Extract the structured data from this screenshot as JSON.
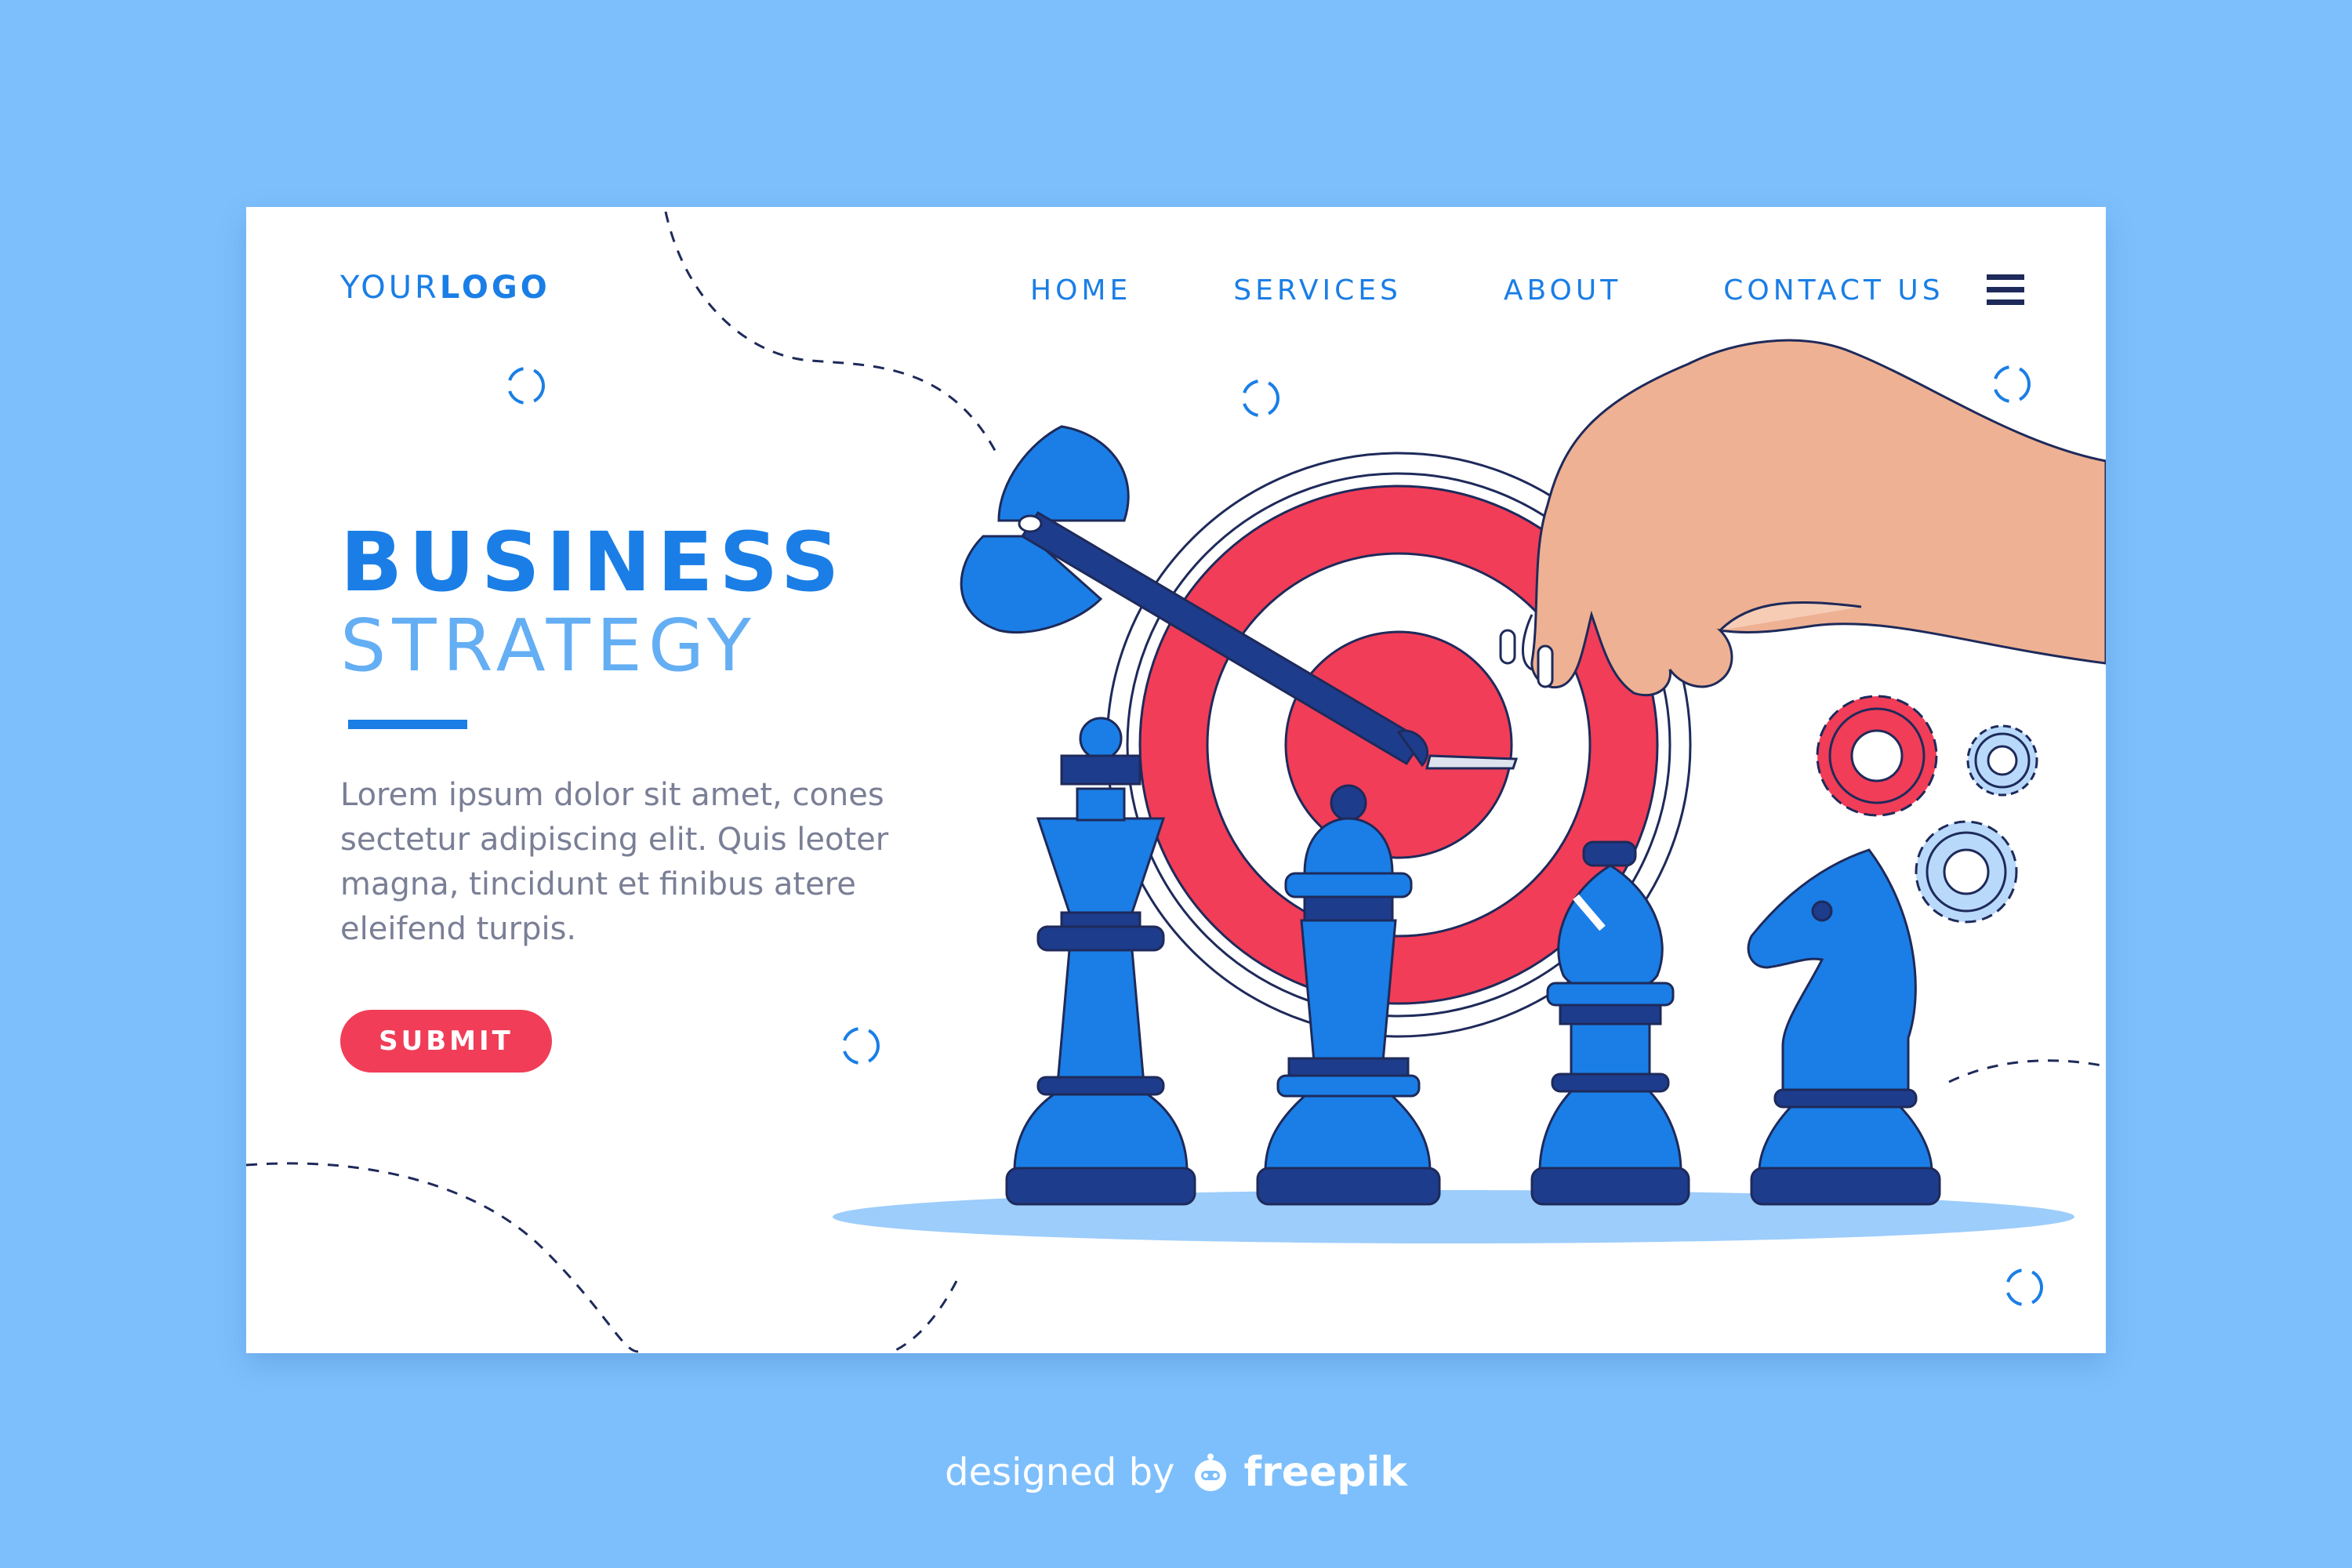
{
  "header": {
    "logo_prefix": "YOUR",
    "logo_suffix": "LOGO",
    "nav": [
      {
        "label": "HOME"
      },
      {
        "label": "SERVICES"
      },
      {
        "label": "ABOUT"
      },
      {
        "label": "CONTACT US"
      }
    ],
    "menu_icon": "hamburger-menu-icon"
  },
  "hero": {
    "title_line1": "BUSINESS",
    "title_line2": "STRATEGY",
    "body": "Lorem ipsum dolor sit amet, cones sectetur adipiscing elit. Quis leoter magna, tincidunt et finibus atere eleifend turpis.",
    "submit_label": "SUBMIT"
  },
  "illustration": {
    "items": [
      "target-icon",
      "dart-icon",
      "hand-icon",
      "gear-icon",
      "chess-king-icon",
      "chess-queen-icon",
      "chess-bishop-icon",
      "chess-knight-icon"
    ]
  },
  "footer": {
    "credit_prefix": "designed by",
    "credit_brand": "freepik"
  },
  "colors": {
    "background": "#7dbffc",
    "primary_blue": "#1a7ee6",
    "light_blue": "#64aef4",
    "red": "#f13d58",
    "navy": "#1e2a5a",
    "text_gray": "#7a7f96"
  }
}
